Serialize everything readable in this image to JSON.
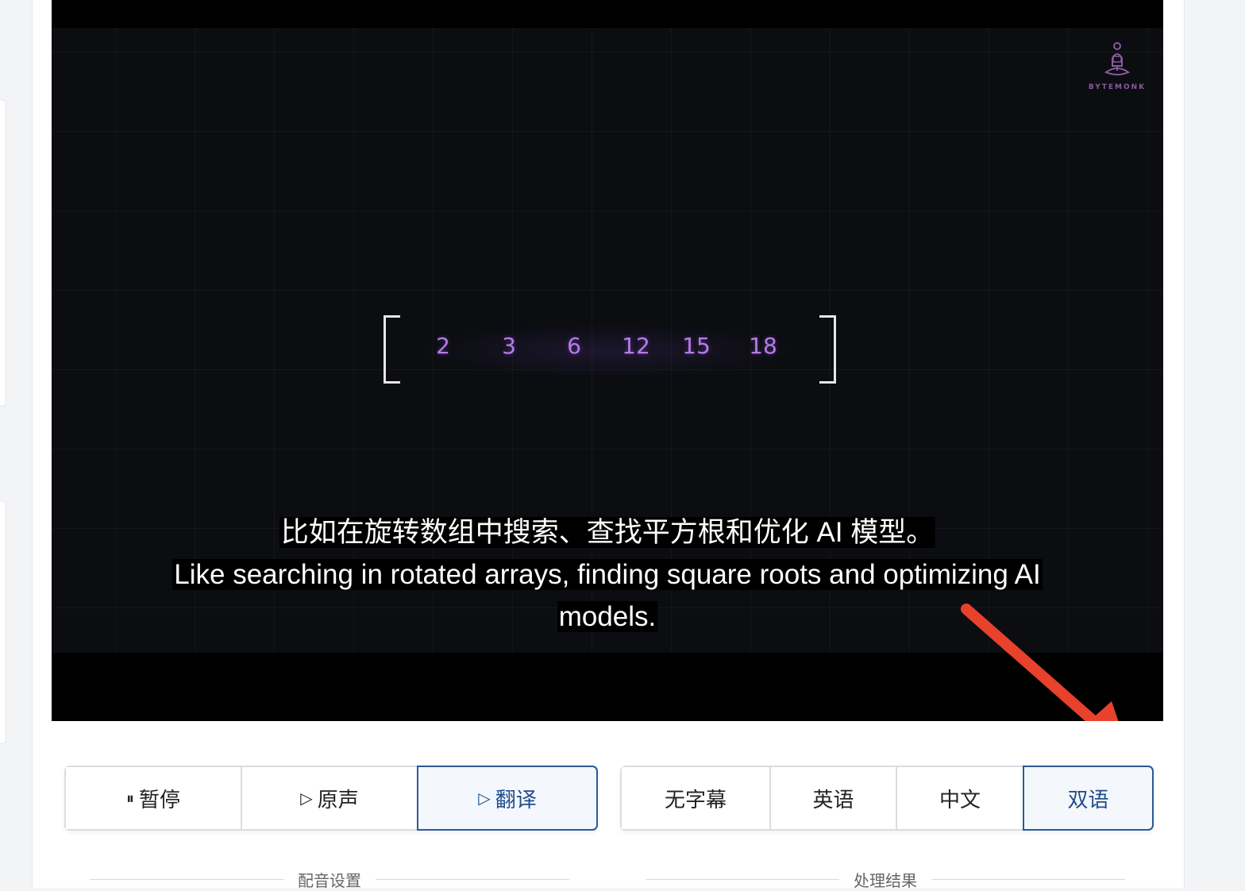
{
  "video": {
    "logo_text": "BYTEMONK",
    "array_values": [
      "2",
      "3",
      "6",
      "12",
      "15",
      "18"
    ],
    "subtitle_zh": "比如在旋转数组中搜索、查找平方根和优化 AI 模型。",
    "subtitle_en_line1": "Like searching in rotated arrays, finding square roots and optimizing AI",
    "subtitle_en_line2": "models."
  },
  "playback": {
    "pause": {
      "icon": "pause-icon",
      "label": "暂停"
    },
    "original": {
      "icon": "play-icon",
      "label": "原声"
    },
    "translate": {
      "icon": "play-icon",
      "label": "翻译",
      "active": true
    }
  },
  "subtitle_mode": {
    "options": [
      "无字幕",
      "英语",
      "中文",
      "双语"
    ],
    "selected": "双语"
  },
  "sections": {
    "dubbing": "配音设置",
    "results": "处理结果"
  },
  "colors": {
    "accent": "#2b5a96",
    "arrow": "#e8412c",
    "array_number": "#b57be8"
  }
}
